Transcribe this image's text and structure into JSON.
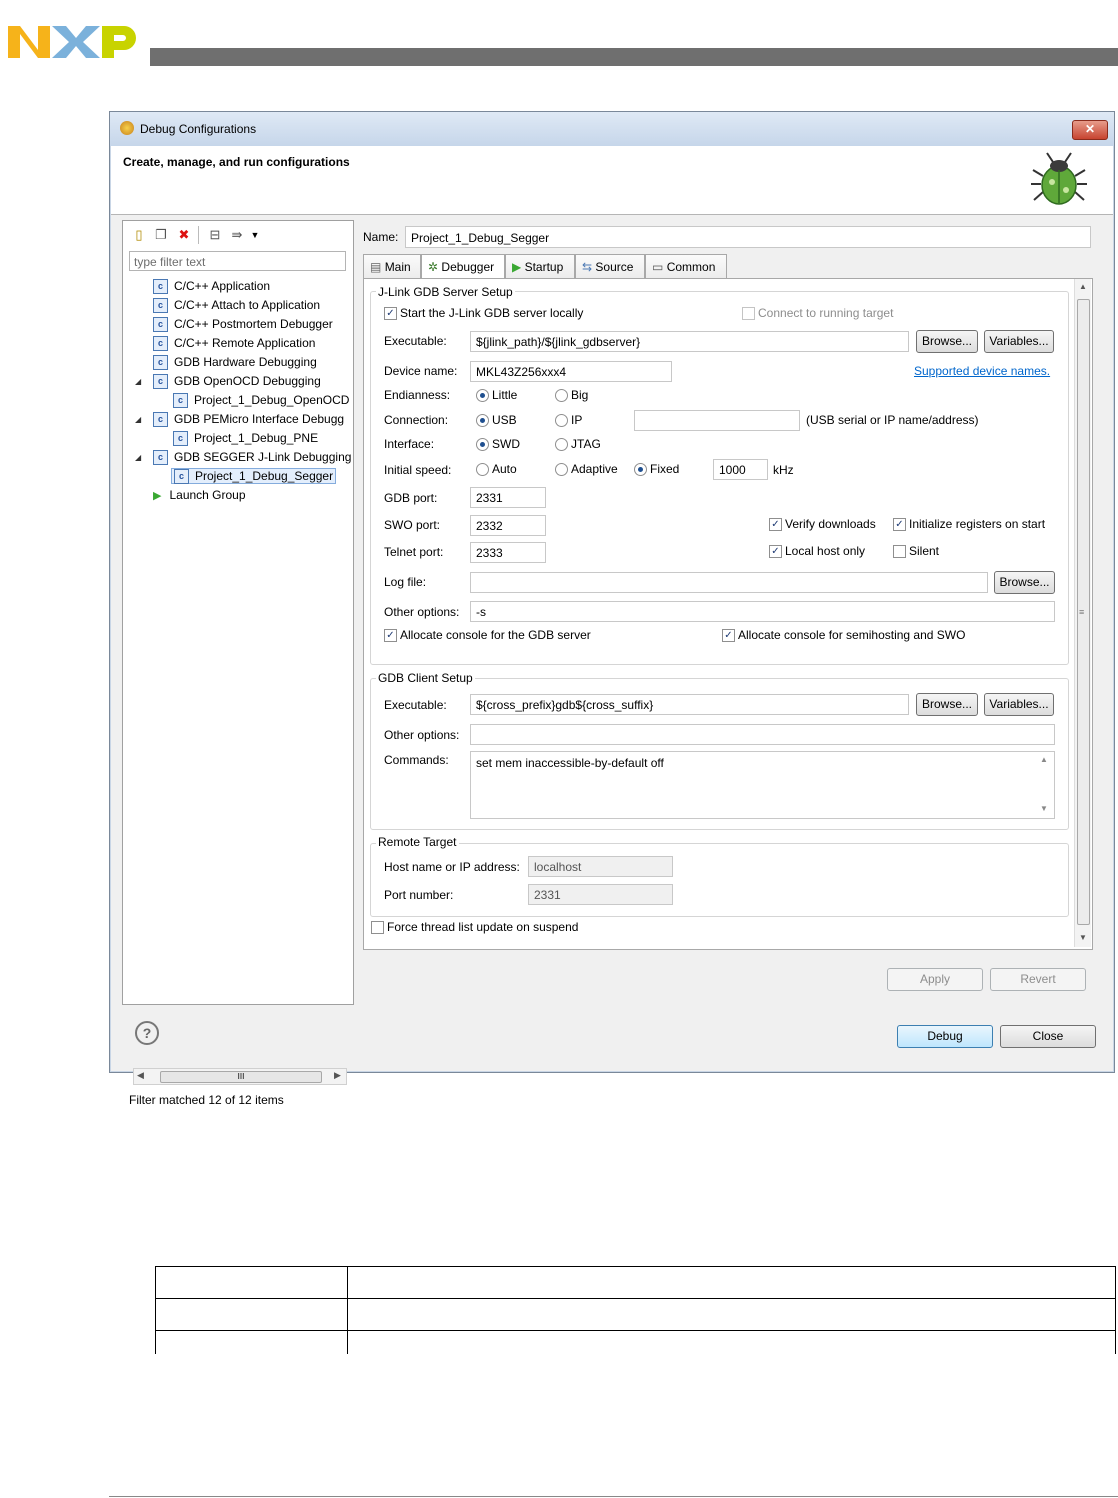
{
  "brand": {
    "logo_text": "NXP",
    "colors": {
      "n": "#f6b31a",
      "x": "#7bb1db",
      "p": "#c8d300",
      "bar": "#6f6f6f"
    }
  },
  "dialog": {
    "title": "Debug Configurations",
    "close_glyph": "✕",
    "banner_title": "Create, manage, and run configurations"
  },
  "left": {
    "filter_placeholder": "type filter text",
    "tree": [
      {
        "label": "C/C++ Application",
        "level": 0
      },
      {
        "label": "C/C++ Attach to Application",
        "level": 0
      },
      {
        "label": "C/C++ Postmortem Debugger",
        "level": 0
      },
      {
        "label": "C/C++ Remote Application",
        "level": 0
      },
      {
        "label": "GDB Hardware Debugging",
        "level": 0
      },
      {
        "label": "GDB OpenOCD Debugging",
        "level": 0
      },
      {
        "label": "Project_1_Debug_OpenOCD",
        "level": 1
      },
      {
        "label": "GDB PEMicro Interface Debugg",
        "level": 0
      },
      {
        "label": "Project_1_Debug_PNE",
        "level": 1
      },
      {
        "label": "GDB SEGGER J-Link Debugging",
        "level": 0
      },
      {
        "label": "Project_1_Debug_Segger",
        "level": 1
      },
      {
        "label": "Launch Group",
        "level": 0
      }
    ],
    "scroll_thumb_label": "III",
    "status": "Filter matched 12 of 12 items"
  },
  "right": {
    "name_label": "Name:",
    "name_value": "Project_1_Debug_Segger",
    "tabs": [
      "Main",
      "Debugger",
      "Startup",
      "Source",
      "Common"
    ],
    "jlink": {
      "group_label": "J-Link GDB Server Setup",
      "start_locally": "Start the J-Link GDB server locally",
      "connect_running": "Connect to running target",
      "executable_label": "Executable:",
      "executable_value": "${jlink_path}/${jlink_gdbserver}",
      "browse": "Browse...",
      "variables": "Variables...",
      "device_label": "Device name:",
      "device_value": "MKL43Z256xxx4",
      "supported_link": "Supported device names.",
      "endianness_label": "Endianness:",
      "little": "Little",
      "big": "Big",
      "connection_label": "Connection:",
      "usb": "USB",
      "ip": "IP",
      "usb_hint": "(USB serial or IP name/address)",
      "interface_label": "Interface:",
      "swd": "SWD",
      "jtag": "JTAG",
      "speed_label": "Initial speed:",
      "auto": "Auto",
      "adaptive": "Adaptive",
      "fixed": "Fixed",
      "speed_value": "1000",
      "khz": "kHz",
      "gdb_port_label": "GDB port:",
      "gdb_port_value": "2331",
      "swo_port_label": "SWO port:",
      "swo_port_value": "2332",
      "telnet_label": "Telnet port:",
      "telnet_value": "2333",
      "verify": "Verify downloads",
      "init_regs": "Initialize registers on start",
      "local_host": "Local host only",
      "silent": "Silent",
      "log_label": "Log file:",
      "other_label": "Other options:",
      "other_value": "-s",
      "alloc_gdb": "Allocate console for the GDB server",
      "alloc_semi": "Allocate console for semihosting and SWO"
    },
    "client": {
      "group_label": "GDB Client Setup",
      "executable_label": "Executable:",
      "executable_value": "${cross_prefix}gdb${cross_suffix}",
      "other_label": "Other options:",
      "commands_label": "Commands:",
      "commands_value": "set mem inaccessible-by-default off"
    },
    "remote": {
      "group_label": "Remote Target",
      "host_label": "Host name or IP address:",
      "host_value": "localhost",
      "port_label": "Port number:",
      "port_value": "2331"
    },
    "force_thread": "Force thread list update on suspend",
    "apply": "Apply",
    "revert": "Revert"
  },
  "bottom": {
    "help_glyph": "?",
    "debug": "Debug",
    "close": "Close"
  }
}
